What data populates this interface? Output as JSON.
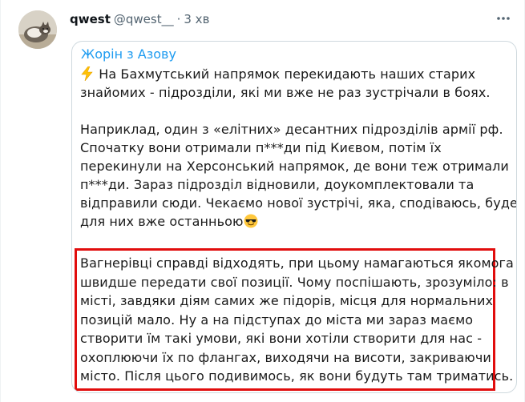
{
  "tweet": {
    "author": {
      "name": "qwest",
      "handle": "@qwest__",
      "separator": "·",
      "time": "3 хв"
    },
    "quote": {
      "channel": "Жорін з Азову",
      "paragraphs": [
        {
          "lines": [
            "На Бахмутський напрямок перекидають наших старих",
            "знайомих - підрозділи, які ми вже не раз зустрічали в боях."
          ]
        },
        {
          "lines": [
            "Наприклад, один з «елітних» десантних підрозділів армії рф.",
            "Спочатку вони отримали п***ди під Києвом, потім їх",
            "перекинули на Херсонський напрямок, де вони теж отримали",
            "п***ди. Зараз підрозділ відновили, доукомплектовали та",
            "відправили сюди. Чекаємо нової зустрічі, яка, сподіваюсь, буде",
            "для них вже останньою"
          ]
        }
      ],
      "highlighted_lines": [
        "Вагнерівці справді відходять, при цьому намагаються якомога",
        "швидше передати свої позиції. Чому поспішають, зрозуміло: в",
        "місті, завдяки діям самих же підорів, місця для нормальних",
        "позицій мало. Ну а на підступах до міста ми зараз маємо",
        "створити їм такі умови, які вони хотіли створити для нас -",
        "охоплюючи їх по флангах, виходячи на висоти, закриваючи",
        "місто. Після цього подивимось, як вони будуть там триматись."
      ],
      "icons": {
        "lead": "lightning-emoji",
        "trail": "sunglasses-emoji"
      }
    }
  },
  "colors": {
    "link": "#1d9bf0",
    "highlight_border": "#e10d0d",
    "secondary_text": "#536471"
  }
}
